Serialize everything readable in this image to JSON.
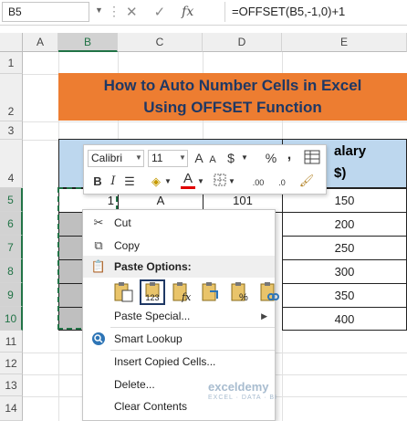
{
  "formula_bar": {
    "name_box": "B5",
    "cancel_icon": "✕",
    "enter_icon": "✓",
    "fx_label": "fx",
    "formula": "=OFFSET(B5,-1,0)+1"
  },
  "columns": [
    "A",
    "B",
    "C",
    "D",
    "E"
  ],
  "rows": [
    "1",
    "2",
    "3",
    "4",
    "5",
    "6",
    "7",
    "8",
    "9",
    "10",
    "11",
    "12",
    "13",
    "14"
  ],
  "selected_column": "B",
  "title": {
    "line1": "How to Auto Number Cells in Excel",
    "line2": "Using OFFSET Function"
  },
  "table": {
    "salary_header_line1": "alary",
    "salary_header_line2": "$)",
    "rows": [
      {
        "b": "1",
        "c": "A",
        "d": "101",
        "e": "150"
      },
      {
        "b": "",
        "c": "",
        "d": "",
        "e": "200"
      },
      {
        "b": "",
        "c": "",
        "d": "",
        "e": "250"
      },
      {
        "b": "",
        "c": "",
        "d": "",
        "e": "300"
      },
      {
        "b": "",
        "c": "",
        "d": "",
        "e": "350"
      },
      {
        "b": "",
        "c": "",
        "d": "",
        "e": "400"
      }
    ]
  },
  "mini_toolbar": {
    "font_name": "Calibri",
    "font_size": "11",
    "grow_font": "A",
    "shrink_font": "A",
    "currency": "$",
    "percent": "%",
    "comma": ",",
    "bold": "B",
    "italic": "I",
    "font_color": "A",
    "increase_decimal": ".00",
    "decrease_decimal": ".0"
  },
  "context_menu": {
    "cut": "Cut",
    "copy": "Copy",
    "paste_options": "Paste Options:",
    "paste_values_label": "123",
    "paste_special": "Paste Special...",
    "smart_lookup": "Smart Lookup",
    "insert_copied": "Insert Copied Cells...",
    "delete": "Delete...",
    "clear_contents": "Clear Contents"
  },
  "colors": {
    "title_fill": "#ed7d31",
    "title_text": "#1f3864",
    "header_fill": "#bdd7ee",
    "selected_accent": "#217346"
  },
  "watermark": {
    "name": "exceldemy",
    "tagline": "EXCEL · DATA · BI"
  }
}
